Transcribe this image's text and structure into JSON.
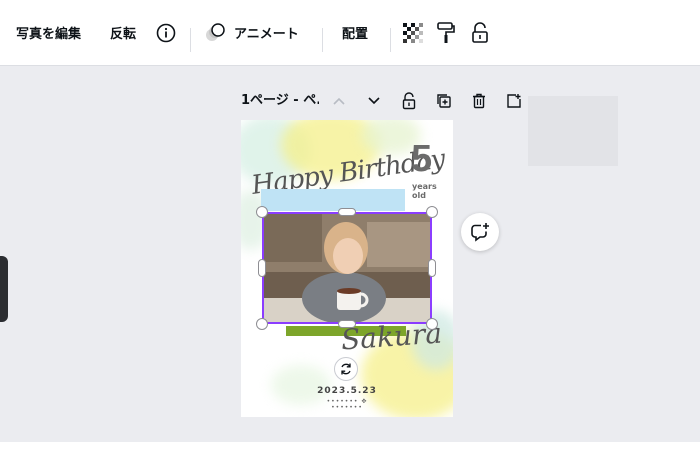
{
  "toolbar": {
    "edit_photo": "写真を編集",
    "flip": "反転",
    "animate": "アニメート",
    "position": "配置"
  },
  "page": {
    "label": "1ページ - ペ."
  },
  "design": {
    "title": "Happy Birthday",
    "age": "5",
    "age_unit_1": "years",
    "age_unit_2": "old",
    "name": "Sakura",
    "date": "2023.5.23",
    "ornament": "••••••• ✥ •••••••"
  },
  "colors": {
    "accent": "#8b3dff",
    "green_bar": "#7da52a",
    "blue_band": "#bfe3f5"
  }
}
